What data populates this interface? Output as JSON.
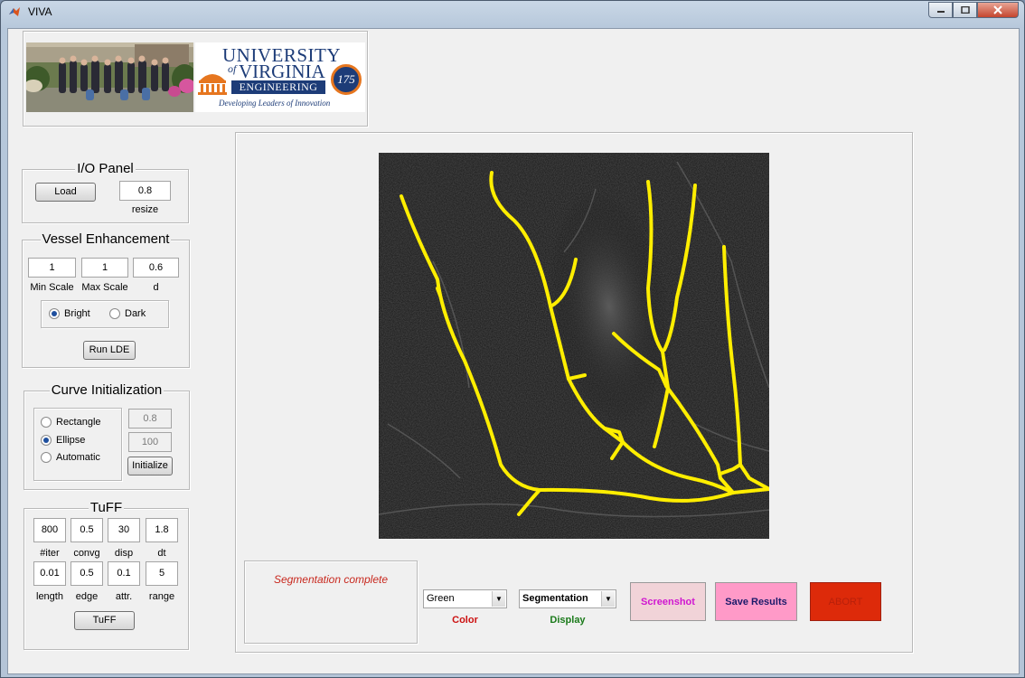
{
  "window": {
    "title": "VIVA"
  },
  "header": {
    "logo_line1": "UNIVERSITY",
    "logo_line2": "of",
    "logo_line3": "VIRGINIA",
    "logo_banner": "ENGINEERING",
    "logo_tagline": "Developing Leaders of Innovation",
    "seal_text": "175"
  },
  "io_panel": {
    "title": "I/O Panel",
    "load_label": "Load",
    "resize_value": "0.8",
    "resize_label": "resize"
  },
  "vessel_enhancement": {
    "title": "Vessel Enhancement",
    "min_scale_value": "1",
    "max_scale_value": "1",
    "d_value": "0.6",
    "min_scale_label": "Min Scale",
    "max_scale_label": "Max Scale",
    "d_label": "d",
    "bright_label": "Bright",
    "dark_label": "Dark",
    "selected": "Bright",
    "run_label": "Run LDE"
  },
  "curve_init": {
    "title": "Curve Initialization",
    "rectangle_label": "Rectangle",
    "ellipse_label": "Ellipse",
    "automatic_label": "Automatic",
    "selected": "Ellipse",
    "field1_value": "0.8",
    "field2_value": "100",
    "initialize_label": "Initialize"
  },
  "tuff": {
    "title": "TuFF",
    "row1": [
      {
        "value": "800",
        "label": "#iter"
      },
      {
        "value": "0.5",
        "label": "convg"
      },
      {
        "value": "30",
        "label": "disp"
      },
      {
        "value": "1.8",
        "label": "dt"
      }
    ],
    "row2": [
      {
        "value": "0.01",
        "label": "length"
      },
      {
        "value": "0.5",
        "label": "edge"
      },
      {
        "value": "0.1",
        "label": "attr."
      },
      {
        "value": "5",
        "label": "range"
      }
    ],
    "run_label": "TuFF"
  },
  "status": {
    "message": "Segmentation complete"
  },
  "controls": {
    "color_value": "Green",
    "color_label": "Color",
    "display_value": "Segmentation",
    "display_label": "Display",
    "screenshot_label": "Screenshot",
    "save_label": "Save Results",
    "abort_label": "ABORT"
  },
  "colors": {
    "segmentation": "#ffee00",
    "status_text": "#c8281e",
    "color_label": "#cc1111",
    "display_label": "#1a7a1a",
    "screenshot_bg": "#f1d3d8",
    "screenshot_text": "#d016d0",
    "save_bg": "#ff9ac8",
    "save_text": "#1a1a6a",
    "abort_bg": "#dd2a0a",
    "abort_text": "#b8200a"
  }
}
